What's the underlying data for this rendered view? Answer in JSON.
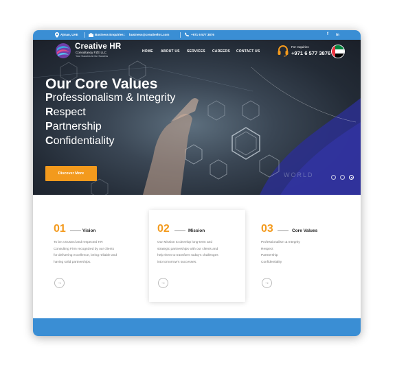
{
  "topbar": {
    "location": "Ajman, UAE",
    "enquiries_label": "Business Enquiries :",
    "enquiries_email": "business@creativehrc.com",
    "phone": "+971 6 577 3876",
    "social": [
      "facebook-icon",
      "linkedin-icon"
    ]
  },
  "brand": {
    "name": "Creative HR",
    "subtitle": "Consultancy FZE LLC",
    "tagline": "Your Success is Our Success"
  },
  "nav": {
    "items": [
      "HOME",
      "ABOUT US",
      "SERVICES",
      "CAREERS",
      "CONTACT US"
    ],
    "inquiry_label": "For Inquiries",
    "inquiry_phone": "+971 6 577 3876"
  },
  "hero": {
    "title": "Our Core Values",
    "values": [
      {
        "initial": "P",
        "rest": "rofessionalism & Integrity"
      },
      {
        "initial": "R",
        "rest": "espect"
      },
      {
        "initial": "P",
        "rest": "artnership"
      },
      {
        "initial": "C",
        "rest": "onfidentiality"
      }
    ],
    "cta": "Discover More",
    "slides_total": 3,
    "active_slide": 3
  },
  "features": [
    {
      "number": "01",
      "title": "Vision",
      "lines": [
        "To be a trusted and respected HR",
        "Consulting Firm recognized by our clients",
        "for delivering excellence, being reliable and",
        "having solid partnerships."
      ]
    },
    {
      "number": "02",
      "title": "Mission",
      "lines": [
        "Our Mission to develop long-term and",
        "strategic partnerships with our clients and",
        "help them to transform today's challenges",
        "into tomorrow's successes."
      ]
    },
    {
      "number": "03",
      "title": "Core Values",
      "lines": [
        "Professionalism & Integrity",
        "Respect",
        "Partnership",
        "Confidentiality"
      ]
    }
  ],
  "colors": {
    "accent_orange": "#f39a1d",
    "brand_blue": "#3a8ed4"
  },
  "icons": {
    "arrow": "→",
    "location": "map-pin-icon",
    "enquiry": "briefcase-icon",
    "phone": "phone-icon",
    "support": "headset-icon"
  }
}
